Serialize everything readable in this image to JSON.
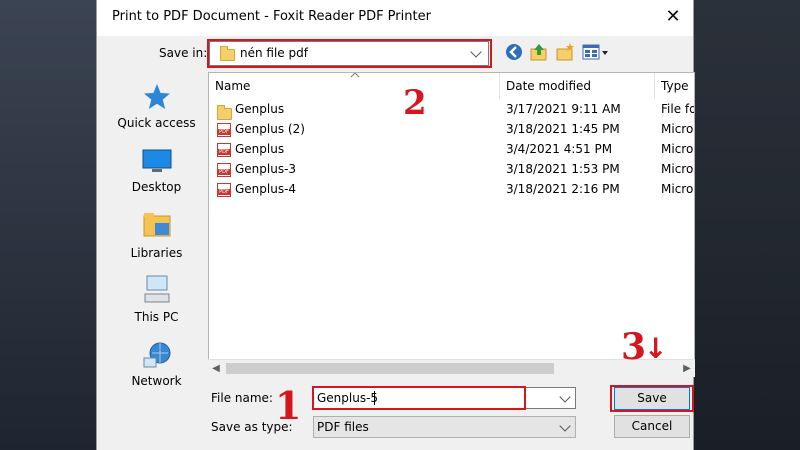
{
  "window": {
    "title": "Print to PDF Document - Foxit Reader PDF Printer",
    "close_glyph": "✕"
  },
  "save_in": {
    "label": "Save in:",
    "value": "nén file pdf"
  },
  "places": [
    {
      "label": "Quick access",
      "icon": "star-icon"
    },
    {
      "label": "Desktop",
      "icon": "desktop-icon"
    },
    {
      "label": "Libraries",
      "icon": "libraries-icon"
    },
    {
      "label": "This PC",
      "icon": "computer-icon"
    },
    {
      "label": "Network",
      "icon": "network-icon"
    }
  ],
  "columns": {
    "name": "Name",
    "date": "Date modified",
    "type": "Type"
  },
  "files": [
    {
      "name": "Genplus",
      "date": "3/17/2021 9:11 AM",
      "type": "File fo",
      "icon": "folder-icon"
    },
    {
      "name": "Genplus (2)",
      "date": "3/18/2021 1:45 PM",
      "type": "Micro",
      "icon": "pdf-icon"
    },
    {
      "name": "Genplus",
      "date": "3/4/2021 4:51 PM",
      "type": "Micro",
      "icon": "pdf-icon"
    },
    {
      "name": "Genplus-3",
      "date": "3/18/2021 1:53 PM",
      "type": "Micro",
      "icon": "pdf-icon"
    },
    {
      "name": "Genplus-4",
      "date": "3/18/2021 2:16 PM",
      "type": "Micro",
      "icon": "pdf-icon"
    }
  ],
  "file_name": {
    "label": "File name:",
    "value": "Genplus-5"
  },
  "save_as_type": {
    "label": "Save as type:",
    "value": "PDF files"
  },
  "buttons": {
    "save": "Save",
    "cancel": "Cancel"
  },
  "annotations": {
    "one": "1",
    "two": "2",
    "three": "3",
    "arrow": "↓"
  },
  "colors": {
    "annotation": "#d4161e",
    "accent": "#0078d7"
  }
}
